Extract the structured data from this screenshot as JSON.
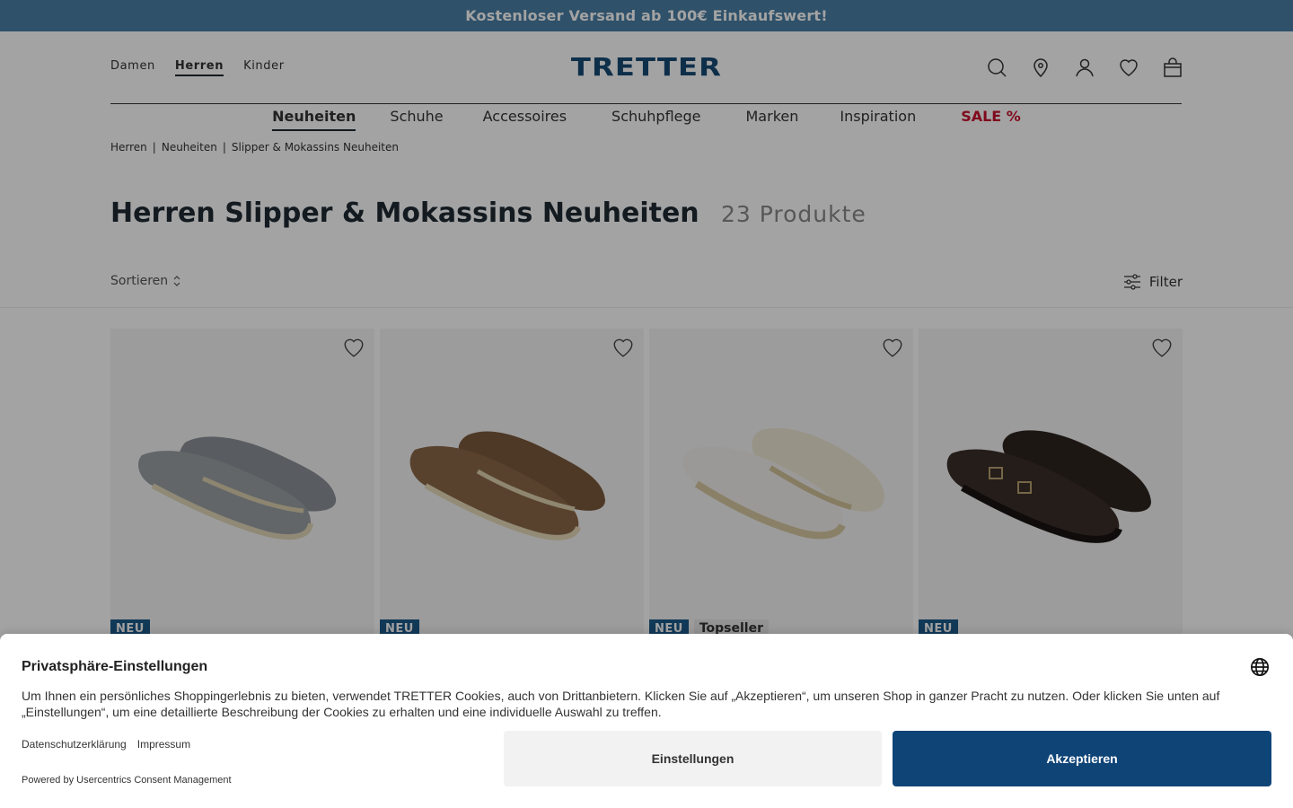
{
  "promo": {
    "text": "Kostenloser Versand ab 100€ Einkaufswert!"
  },
  "header": {
    "gender_nav": [
      {
        "label": "Damen"
      },
      {
        "label": "Herren",
        "active": true
      },
      {
        "label": "Kinder"
      }
    ],
    "logo": "TRETTER",
    "icons": [
      "search-icon",
      "location-pin-icon",
      "account-icon",
      "heart-icon",
      "bag-icon"
    ]
  },
  "main_nav": [
    {
      "label": "Neuheiten",
      "active": true
    },
    {
      "label": "Schuhe"
    },
    {
      "label": "Accessoires"
    },
    {
      "label": "Schuhpflege"
    },
    {
      "label": "Marken"
    },
    {
      "label": "Inspiration"
    },
    {
      "label": "SALE %",
      "sale": true
    }
  ],
  "breadcrumb": [
    "Herren",
    "Neuheiten",
    "Slipper & Mokassins Neuheiten"
  ],
  "page": {
    "title": "Herren Slipper & Mokassins Neuheiten",
    "count": "23 Produkte"
  },
  "toolbar": {
    "sort_label": "Sortieren",
    "filter_label": "Filter"
  },
  "products": [
    {
      "badges": [
        "NEU"
      ],
      "color": "grey"
    },
    {
      "badges": [
        "NEU"
      ],
      "color": "brown"
    },
    {
      "badges": [
        "NEU",
        "Topseller"
      ],
      "color": "white"
    },
    {
      "badges": [
        "NEU"
      ],
      "color": "dark-brown"
    }
  ],
  "consent": {
    "title": "Privatsphäre-Einstellungen",
    "text": "Um Ihnen ein persönliches Shoppingerlebnis zu bieten, verwendet TRETTER Cookies, auch von Drittanbietern. Klicken Sie auf „Akzeptieren“, um unseren Shop in ganzer Pracht zu nutzen. Oder klicken Sie unten auf „Einstellungen“, um eine detaillierte Beschreibung der Cookies zu erhalten und eine individuelle Auswahl zu treffen.",
    "links": [
      "Datenschutzerklärung",
      "Impressum"
    ],
    "powered": "Powered by Usercentrics Consent Management",
    "settings_label": "Einstellungen",
    "accept_label": "Akzeptieren"
  },
  "colors": {
    "promo_bg": "#4a7fa6",
    "brand_blue": "#174a74",
    "accept_bg": "#0f4477",
    "sale_red": "#c8102e",
    "badge_neu": "#1c5a8a"
  }
}
